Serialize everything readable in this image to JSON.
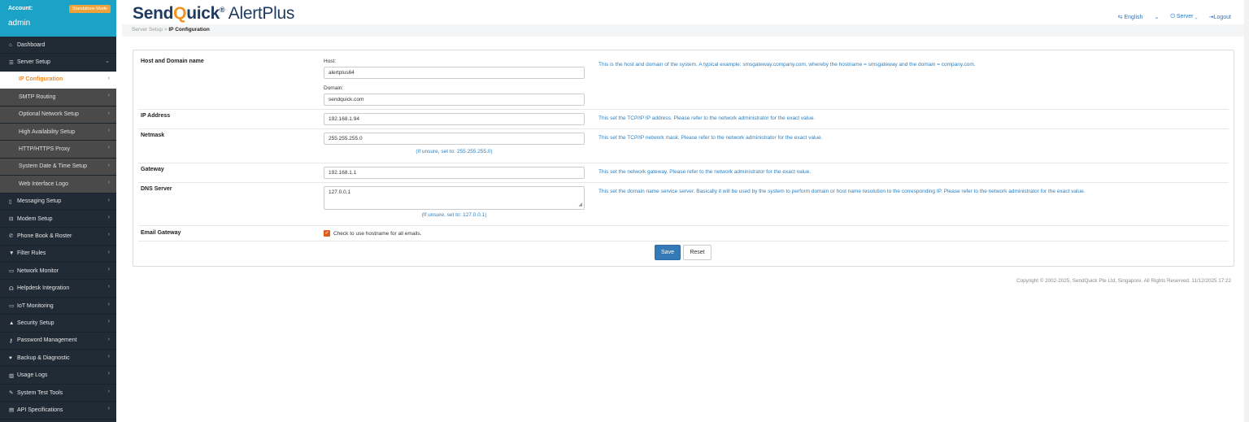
{
  "account": {
    "label": "Account:",
    "mode": "Standalone Mode",
    "user": "admin"
  },
  "nav": [
    {
      "label": "Dashboard",
      "icon": "⌂",
      "chev": ""
    },
    {
      "label": "Server Setup",
      "icon": "☰",
      "chev": "⌄"
    }
  ],
  "subnav": [
    {
      "label": "IP Configuration",
      "chev": "›"
    },
    {
      "label": "SMTP Routing",
      "chev": "›"
    },
    {
      "label": "Optional Network Setup",
      "chev": "›"
    },
    {
      "label": "High Availability Setup",
      "chev": "›"
    },
    {
      "label": "HTTP/HTTPS Proxy",
      "chev": "›"
    },
    {
      "label": "System Date & Time Setup",
      "chev": "›"
    },
    {
      "label": "Web Interface Logo",
      "chev": "›"
    }
  ],
  "nav2": [
    {
      "label": "Messaging Setup",
      "icon": "▯",
      "chev": "›"
    },
    {
      "label": "Modem Setup",
      "icon": "⊟",
      "chev": "›"
    },
    {
      "label": "Phone Book & Roster",
      "icon": "✆",
      "chev": "›"
    },
    {
      "label": "Filter Rules",
      "icon": "▼",
      "chev": "›"
    },
    {
      "label": "Network Monitor",
      "icon": "▭",
      "chev": "›"
    },
    {
      "label": "Helpdesk Integration",
      "icon": "☊",
      "chev": "›"
    },
    {
      "label": "IoT Monitoring",
      "icon": "▭",
      "chev": "›"
    },
    {
      "label": "Security Setup",
      "icon": "▲",
      "chev": "›"
    },
    {
      "label": "Password Management",
      "icon": "⚷",
      "chev": "›"
    },
    {
      "label": "Backup & Diagnostic",
      "icon": "♥",
      "chev": "›"
    },
    {
      "label": "Usage Logs",
      "icon": "▥",
      "chev": "›"
    },
    {
      "label": "System Test Tools",
      "icon": "✎",
      "chev": "›"
    },
    {
      "label": "API Specifications",
      "icon": "▤",
      "chev": "›"
    }
  ],
  "logo": {
    "send": "Send",
    "q": "Q",
    "uick": "uick",
    "reg": "®",
    "alert": " AlertPlus"
  },
  "topnav": {
    "language": "English",
    "lang_chev": "⌄",
    "server": "Server",
    "server_chev": "⌄",
    "logout": "Logout"
  },
  "breadcrumb": {
    "parent": "Server Setup",
    "sep": " > ",
    "current": "IP Configuration"
  },
  "form": {
    "host_domain": {
      "label": "Host and Domain name",
      "host_label": "Host:",
      "host_value": "alertplus64",
      "domain_label": "Domain:",
      "domain_value": "sendquick.com",
      "desc": "This is the host and domain of the system. A typical example: smsgateway.company.com, whereby the hostname = smsgateway and the domain = company.com."
    },
    "ip": {
      "label": "IP Address",
      "value": "192.168.1.94",
      "desc": "This set the TCP/IP IP address. Please refer to the network administrator for the exact value."
    },
    "netmask": {
      "label": "Netmask",
      "value": "255.255.255.0",
      "hint": "(If unsure, set to: 255.255.255.0)",
      "desc": "This set the TCP/IP network mask. Please refer to the network administrator for the exact value."
    },
    "gateway": {
      "label": "Gateway",
      "value": "192.168.1.1",
      "desc": "This set the network gateway. Please refer to the network administrator for the exact value."
    },
    "dns": {
      "label": "DNS Server",
      "value": "127.0.0.1",
      "hint": "(If unsure, set to: 127.0.0.1)",
      "desc": "This set the domain name service server. Basically it will be used by the system to perform domain or host name resolution to the corresponding IP. Please refer to the network administrator for the exact value."
    },
    "email_gateway": {
      "label": "Email Gateway",
      "checkbox_label": "Check to use hostname for all emails.",
      "checked": true
    },
    "save": "Save",
    "reset": "Reset"
  },
  "copyright": "Copyright © 2002-2025, SendQuick Pte Ltd, Singapore. All Rights Reserved. 11/12/2025 17:22"
}
